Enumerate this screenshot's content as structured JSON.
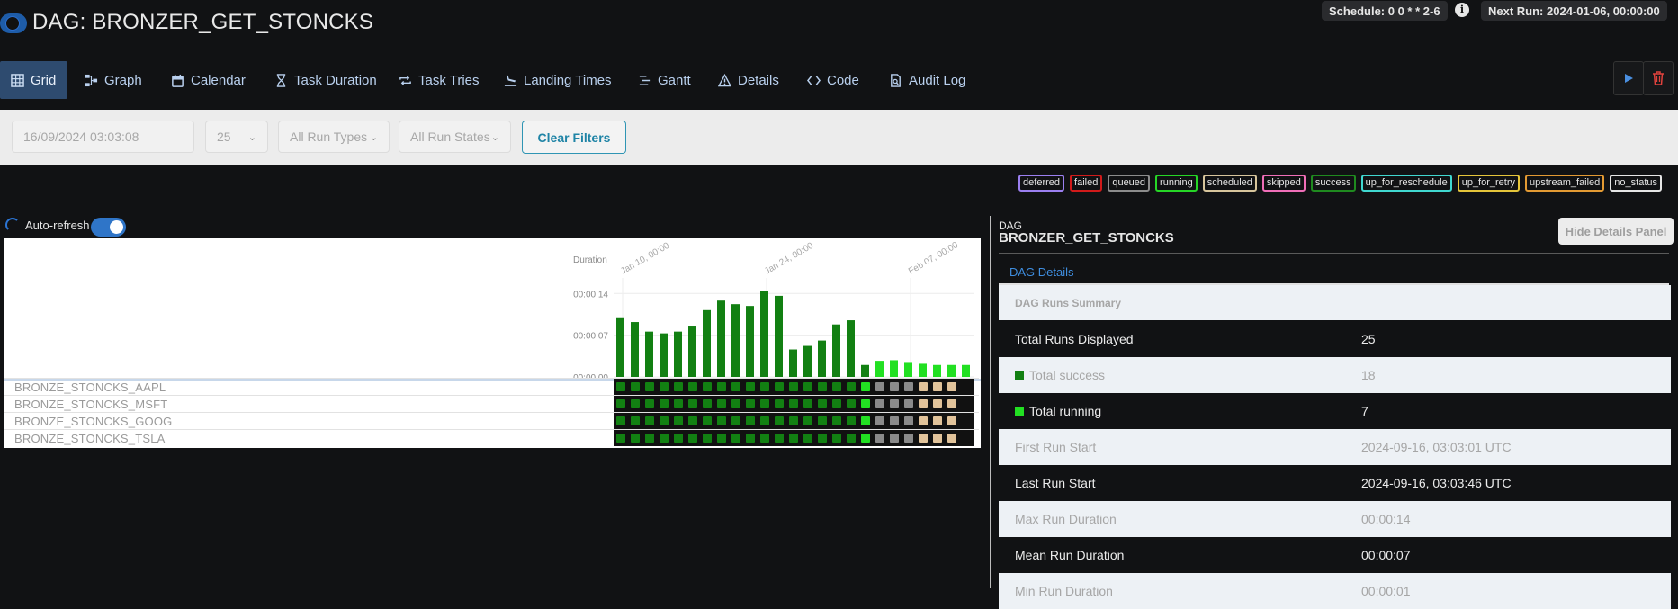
{
  "header": {
    "title": "DAG: BRONZER_GET_STONCKS",
    "schedule": "Schedule: 0 0 * * 2-6",
    "next_run": "Next Run: 2024-01-06, 00:00:00",
    "info_glyph": "i"
  },
  "tabs": [
    {
      "label": "Grid",
      "icon": "grid-icon"
    },
    {
      "label": "Graph",
      "icon": "graph-icon"
    },
    {
      "label": "Calendar",
      "icon": "calendar-icon"
    },
    {
      "label": "Task Duration",
      "icon": "hourglass-icon"
    },
    {
      "label": "Task Tries",
      "icon": "repeat-icon"
    },
    {
      "label": "Landing Times",
      "icon": "landing-icon"
    },
    {
      "label": "Gantt",
      "icon": "gantt-icon"
    },
    {
      "label": "Details",
      "icon": "warning-triangle-icon"
    },
    {
      "label": "Code",
      "icon": "code-icon"
    },
    {
      "label": "Audit Log",
      "icon": "audit-log-icon"
    }
  ],
  "filters": {
    "base_date": "16/09/2024 03:03:08",
    "num_runs": "25",
    "run_types": "All Run Types",
    "run_states": "All Run States",
    "clear_label": "Clear Filters"
  },
  "legend": [
    {
      "label": "deferred",
      "color": "#9b7ff0"
    },
    {
      "label": "failed",
      "color": "#d11a1a"
    },
    {
      "label": "queued",
      "color": "#8c8c8c"
    },
    {
      "label": "running",
      "color": "#26d626"
    },
    {
      "label": "scheduled",
      "color": "#d7c59c"
    },
    {
      "label": "skipped",
      "color": "#f06eb8"
    },
    {
      "label": "success",
      "color": "#1f8a1f"
    },
    {
      "label": "up_for_reschedule",
      "color": "#40d8d0"
    },
    {
      "label": "up_for_retry",
      "color": "#e5c53a"
    },
    {
      "label": "upstream_failed",
      "color": "#e39a33"
    },
    {
      "label": "no_status",
      "color": "#e6e6e6"
    }
  ],
  "auto_refresh_label": "Auto-refresh",
  "chart_data": {
    "type": "bar",
    "ylabel": "Duration",
    "yticks": [
      "00:00:00",
      "00:00:07",
      "00:00:14"
    ],
    "ylim": [
      0,
      16
    ],
    "xticks": [
      "Jan 10, 00:00",
      "Jan 24, 00:00",
      "Feb 07, 00:00"
    ],
    "values": [
      10.0,
      9.2,
      7.6,
      7.3,
      7.6,
      8.6,
      11.2,
      12.8,
      12.2,
      11.9,
      14.4,
      13.6,
      4.6,
      5.2,
      6.1,
      8.8,
      9.5,
      2.0,
      2.7,
      2.8,
      2.5,
      2.2,
      2.0,
      2.0,
      2.0
    ],
    "states": [
      "success",
      "success",
      "success",
      "success",
      "success",
      "success",
      "success",
      "success",
      "success",
      "success",
      "success",
      "success",
      "success",
      "success",
      "success",
      "success",
      "success",
      "success",
      "running",
      "running",
      "running",
      "running",
      "running",
      "running",
      "running"
    ],
    "colors": {
      "success": "#128012",
      "running": "#22e022"
    }
  },
  "tasks": [
    {
      "name": "BRONZE_STONCKS_AAPL"
    },
    {
      "name": "BRONZE_STONCKS_MSFT"
    },
    {
      "name": "BRONZE_STONCKS_GOOG"
    },
    {
      "name": "BRONZE_STONCKS_TSLA"
    }
  ],
  "task_cell_states": {
    "pattern": [
      "success",
      "success",
      "success",
      "success",
      "success",
      "success",
      "success",
      "success",
      "success",
      "success",
      "success",
      "success",
      "success",
      "success",
      "success",
      "success",
      "success",
      "running",
      "queued",
      "queued",
      "queued",
      "scheduled",
      "scheduled",
      "scheduled"
    ],
    "colors": {
      "success": "#128012",
      "running": "#22e022",
      "queued": "#8a8a8a",
      "scheduled": "#e1c39a"
    }
  },
  "details": {
    "label": "DAG",
    "dag_name": "BRONZER_GET_STONCKS",
    "hide_label": "Hide Details Panel",
    "tab_label": "DAG Details",
    "summary_header": "DAG Runs Summary",
    "rows": [
      {
        "key": "Total Runs Displayed",
        "value": "25"
      },
      {
        "key": "Total success",
        "value": "18",
        "swatch": "#128012"
      },
      {
        "key": "Total running",
        "value": "7",
        "swatch": "#22e022"
      },
      {
        "key": "First Run Start",
        "value": "2024-09-16, 03:03:01 UTC"
      },
      {
        "key": "Last Run Start",
        "value": "2024-09-16, 03:03:46 UTC"
      },
      {
        "key": "Max Run Duration",
        "value": "00:00:14"
      },
      {
        "key": "Mean Run Duration",
        "value": "00:00:07"
      },
      {
        "key": "Min Run Duration",
        "value": "00:00:01"
      }
    ]
  }
}
